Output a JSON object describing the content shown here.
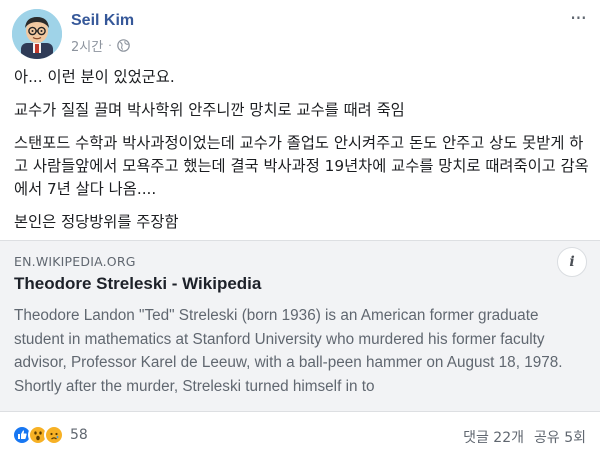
{
  "post": {
    "author": "Seil Kim",
    "time": "2시간",
    "separator": "·",
    "privacy_icon": "globe-icon",
    "more_label": "···"
  },
  "content": {
    "paragraphs": [
      "아... 이런 분이 있었군요.",
      "교수가 질질 끌며 박사학위 안주니깐 망치로 교수를 때려 죽임",
      "스탠포드 수학과 박사과정이었는데 교수가 졸업도 안시켜주고 돈도 안주고 상도 못받게 하고 사람들앞에서 모욕주고 했는데 결국 박사과정 19년차에 교수를 망치로 때려죽이고 감옥에서 7년 살다 나옴....",
      "본인은 정당방위를 주장함"
    ]
  },
  "link_preview": {
    "domain": "EN.WIKIPEDIA.ORG",
    "title": "Theodore Streleski - Wikipedia",
    "description": "Theodore Landon \"Ted\" Streleski (born 1936) is an American former graduate student in mathematics at Stanford University who murdered his former faculty advisor, Professor Karel de Leeuw, with a ball-peen hammer on August 18, 1978. Shortly after the murder, Streleski turned himself in to",
    "info_label": "i"
  },
  "footer": {
    "reactions": [
      "like-icon",
      "wow-icon",
      "sad-icon"
    ],
    "reaction_count": "58",
    "comments": "댓글 22개",
    "shares": "공유 5회"
  },
  "colors": {
    "author": "#365899",
    "like": "#1877f2",
    "emoji": "#f7b125",
    "card_bg": "#f2f3f5"
  }
}
